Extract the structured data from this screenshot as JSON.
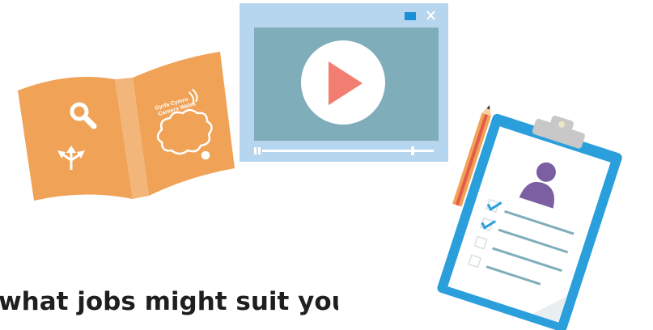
{
  "book": {
    "brand_line1": "Gyrfa Cymru",
    "brand_line2": "Careers Wales",
    "icons": [
      "search-icon",
      "arrows-directions-icon",
      "thought-cloud-icon"
    ],
    "cover_color": "#f0a256",
    "spine_color": "#f3b67a"
  },
  "video_player": {
    "frame_color": "#b6d6ef",
    "screen_color": "#7fadba",
    "play_button_color": "#f17e70",
    "icons": [
      "window-restore-icon",
      "close-icon",
      "play-icon",
      "progress-slider-icon"
    ]
  },
  "clipboard": {
    "board_color": "#2a9fdc",
    "avatar_color": "#7b5fa2",
    "checklist": [
      {
        "checked": true
      },
      {
        "checked": true
      },
      {
        "checked": false
      },
      {
        "checked": false
      }
    ],
    "icons": [
      "pencil-icon",
      "avatar-icon",
      "checkbox-icon"
    ]
  },
  "caption": {
    "text": "what jobs might suit you."
  }
}
